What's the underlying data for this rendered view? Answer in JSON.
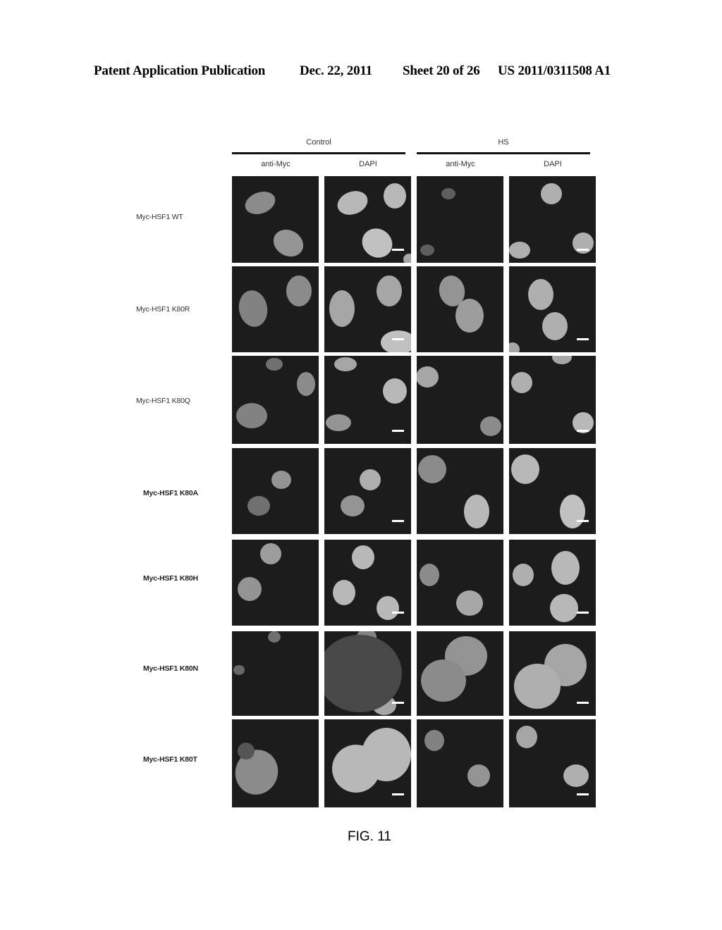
{
  "header": {
    "publication": "Patent Application Publication",
    "date": "Dec. 22, 2011",
    "sheet": "Sheet 20 of 26",
    "number": "US 2011/0311508 A1"
  },
  "figure": {
    "caption": "FIG. 11",
    "groups": [
      {
        "label": "Control",
        "columns": [
          "anti-Myc",
          "DAPI"
        ]
      },
      {
        "label": "HS",
        "columns": [
          "anti-Myc",
          "DAPI"
        ]
      }
    ],
    "rows": [
      {
        "label": "Myc-HSF1 WT"
      },
      {
        "label": "Myc-HSF1 K80R"
      },
      {
        "label": "Myc-HSF1 K80Q"
      },
      {
        "label": "Myc-HSF1 K80A"
      },
      {
        "label": "Myc-HSF1 K80H"
      },
      {
        "label": "Myc-HSF1 K80N"
      },
      {
        "label": "Myc-HSF1 K80T"
      }
    ],
    "panel_contents": "fluorescence micrographs of cell nuclei; DAPI panels include a white scale bar",
    "colors": {
      "panel_background": "#1c1c1c",
      "nucleus": "#9a9a9a",
      "scale_bar": "#ffffff"
    }
  }
}
